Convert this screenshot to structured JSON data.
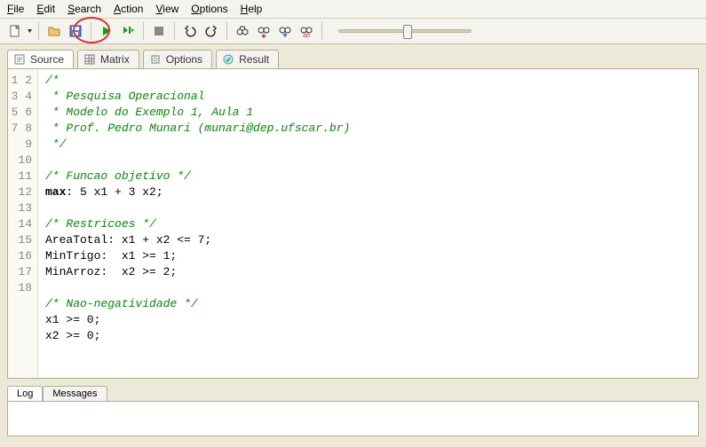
{
  "menu": {
    "file": "File",
    "edit": "Edit",
    "search": "Search",
    "action": "Action",
    "view": "View",
    "options": "Options",
    "help": "Help"
  },
  "tabs": {
    "source": "Source",
    "matrix": "Matrix",
    "options": "Options",
    "result": "Result"
  },
  "code": {
    "lines": [
      {
        "n": 1,
        "t": "comment",
        "s": "/*"
      },
      {
        "n": 2,
        "t": "comment",
        "s": " * Pesquisa Operacional"
      },
      {
        "n": 3,
        "t": "comment",
        "s": " * Modelo do Exemplo 1, Aula 1"
      },
      {
        "n": 4,
        "t": "comment",
        "s": " * Prof. Pedro Munari (munari@dep.ufscar.br)"
      },
      {
        "n": 5,
        "t": "comment",
        "s": " */"
      },
      {
        "n": 6,
        "t": "plain",
        "s": ""
      },
      {
        "n": 7,
        "t": "comment",
        "s": "/* Funcao objetivo */"
      },
      {
        "n": 8,
        "t": "key",
        "key": "max",
        "rest": ": 5 x1 + 3 x2;"
      },
      {
        "n": 9,
        "t": "plain",
        "s": ""
      },
      {
        "n": 10,
        "t": "comment",
        "s": "/* Restricoes */"
      },
      {
        "n": 11,
        "t": "plain",
        "s": "AreaTotal: x1 + x2 <= 7;"
      },
      {
        "n": 12,
        "t": "plain",
        "s": "MinTrigo:  x1 >= 1;"
      },
      {
        "n": 13,
        "t": "plain",
        "s": "MinArroz:  x2 >= 2;"
      },
      {
        "n": 14,
        "t": "plain",
        "s": ""
      },
      {
        "n": 15,
        "t": "comment",
        "s": "/* Nao-negatividade */"
      },
      {
        "n": 16,
        "t": "plain",
        "s": "x1 >= 0;"
      },
      {
        "n": 17,
        "t": "plain",
        "s": "x2 >= 0;"
      },
      {
        "n": 18,
        "t": "plain",
        "s": ""
      }
    ]
  },
  "bottom_tabs": {
    "log": "Log",
    "messages": "Messages"
  }
}
